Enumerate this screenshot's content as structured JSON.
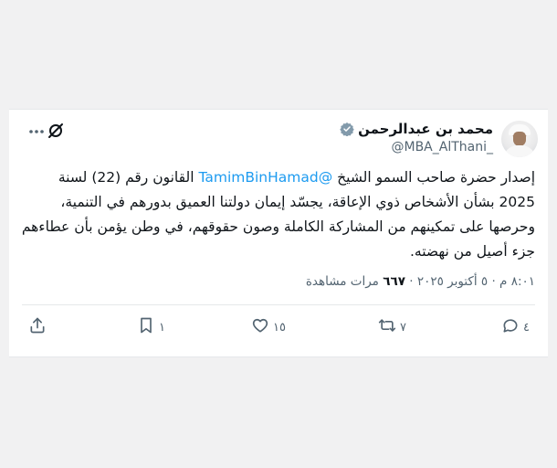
{
  "tweet": {
    "display_name": "محمد بن عبدالرحمن",
    "handle": "@MBA_AlThani_",
    "text_before_mention": "إصدار حضرة صاحب السمو الشيخ ",
    "mention": "@TamimBinHamad",
    "text_after_mention": " القانون رقم (22) لسنة 2025 بشأن الأشخاص ذوي الإعاقة، يجسّد إيمان دولتنا العميق بدورهم في التنمية، وحرصها على تمكينهم من المشاركة الكاملة وصون حقوقهم، في وطن يؤمن بأن عطاءهم جزء أصيل من نهضته.",
    "time": "٨:٠١ م",
    "date": "٥ أكتوبر ٢٠٢٥",
    "views_count": "٦٦٧",
    "views_label": "مرات مشاهدة",
    "separator": "·"
  },
  "actions": {
    "reply_count": "٤",
    "retweet_count": "٧",
    "like_count": "١٥",
    "bookmark_count": "١"
  },
  "colors": {
    "accent": "#1d9bf0",
    "verified_badge": "#829aab",
    "text_primary": "#0f1419",
    "text_secondary": "#536471"
  },
  "icons": {
    "more": "more-icon",
    "grok": "grok-icon",
    "verified": "verified-badge-icon",
    "reply": "reply-icon",
    "retweet": "retweet-icon",
    "like": "heart-icon",
    "bookmark": "bookmark-icon",
    "share": "share-icon"
  }
}
